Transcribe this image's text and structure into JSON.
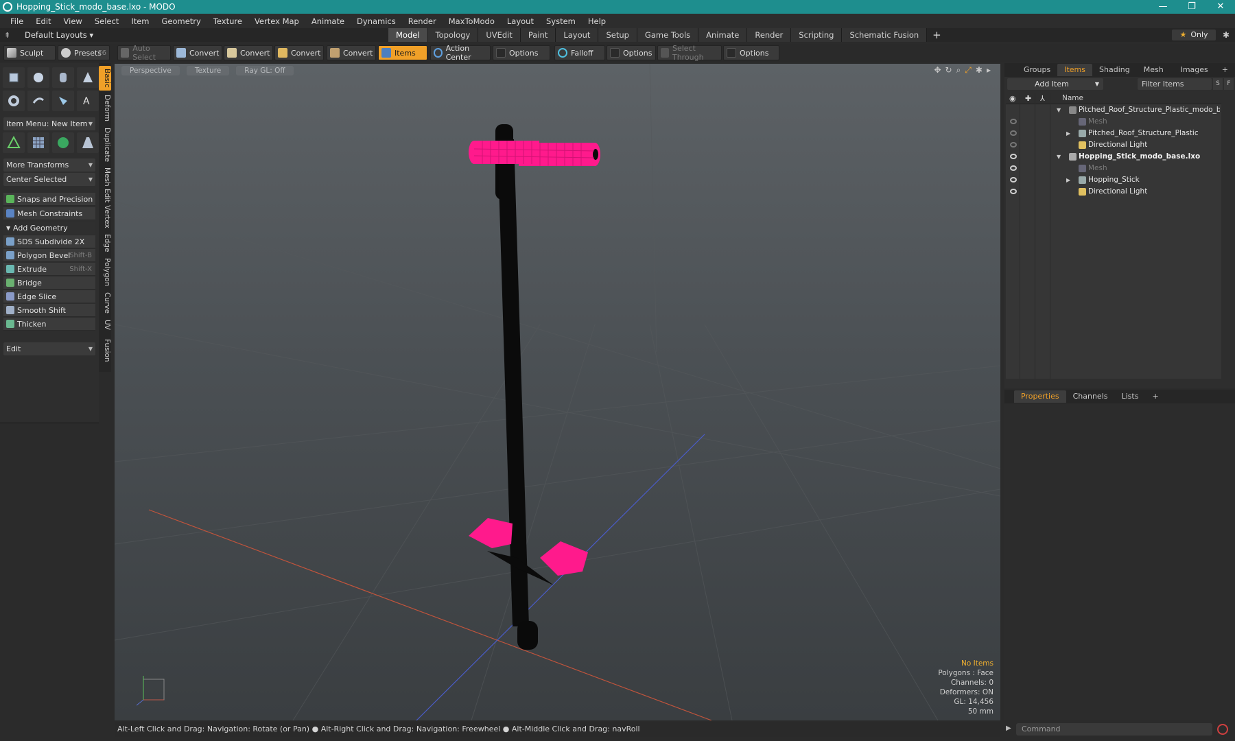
{
  "window": {
    "title": "Hopping_Stick_modo_base.lxo - MODO",
    "controls": [
      "—",
      "❐",
      "✕"
    ]
  },
  "menubar": [
    "File",
    "Edit",
    "View",
    "Select",
    "Item",
    "Geometry",
    "Texture",
    "Vertex Map",
    "Animate",
    "Dynamics",
    "Render",
    "MaxToModo",
    "Layout",
    "System",
    "Help"
  ],
  "layoutbar": {
    "layouts_label": "Default Layouts ▾",
    "tabs": [
      "Model",
      "Topology",
      "UVEdit",
      "Paint",
      "Layout",
      "Setup",
      "Game Tools",
      "Animate",
      "Render",
      "Scripting",
      "Schematic Fusion"
    ],
    "active_tab": "Model",
    "add_tab": "+",
    "only_label": "Only"
  },
  "toolbar": {
    "sculpt": "Sculpt",
    "presets": "Presets",
    "presets_shortcut": "F6",
    "auto_select": "Auto Select",
    "convert1": "Convert",
    "convert2": "Convert",
    "convert3": "Convert",
    "convert4": "Convert",
    "items": "Items",
    "action_center": "Action Center",
    "options1": "Options",
    "falloff": "Falloff",
    "options2": "Options",
    "select_through": "Select Through",
    "options3": "Options"
  },
  "leftpanel": {
    "item_menu": "Item Menu: New Item",
    "more_transforms": "More Transforms",
    "center_selected": "Center Selected",
    "snaps": "Snaps and Precision",
    "mesh_constraints": "Mesh Constraints",
    "add_geometry": "Add Geometry",
    "tools": [
      {
        "label": "SDS Subdivide 2X",
        "shortcut": ""
      },
      {
        "label": "Polygon Bevel",
        "shortcut": "Shift-B"
      },
      {
        "label": "Extrude",
        "shortcut": "Shift-X"
      },
      {
        "label": "Bridge",
        "shortcut": ""
      },
      {
        "label": "Edge Slice",
        "shortcut": ""
      },
      {
        "label": "Smooth Shift",
        "shortcut": ""
      },
      {
        "label": "Thicken",
        "shortcut": ""
      }
    ],
    "edit": "Edit",
    "vtabs": [
      "Basic",
      "Deform",
      "Duplicate",
      "Mesh Edit",
      "Vertex",
      "Edge",
      "Polygon",
      "Curve",
      "UV",
      "Fusion"
    ]
  },
  "viewport": {
    "view_label": "Perspective",
    "shading_label": "Texture",
    "raygl_label": "Ray GL: Off",
    "info": {
      "no_items": "No Items",
      "polygons": "Polygons : Face",
      "channels": "Channels: 0",
      "deformers": "Deformers: ON",
      "gl": "GL: 14,456",
      "scale": "50 mm"
    },
    "colors": {
      "accent_pink": "#ff1a8c",
      "stick_black": "#0a0a0a"
    }
  },
  "statusbar": {
    "text": "Alt-Left Click and Drag: Navigation: Rotate (or Pan) ● Alt-Right Click and Drag: Navigation: Freewheel ● Alt-Middle Click and Drag: navRoll"
  },
  "rightpanel": {
    "tabs": [
      "Groups",
      "Items",
      "Shading",
      "Mesh ...",
      "Images",
      "+"
    ],
    "active_tab": "Items",
    "add_item": "Add Item",
    "filter_items": "Filter Items",
    "s_btn": "S",
    "f_btn": "F",
    "name_col": "Name",
    "tree": [
      {
        "label": "Pitched_Roof_Structure_Plastic_modo_bas...",
        "style": "normal"
      },
      {
        "label": "Mesh",
        "style": "dim"
      },
      {
        "label": "Pitched_Roof_Structure_Plastic",
        "style": "normal"
      },
      {
        "label": "Directional Light",
        "style": "normal"
      },
      {
        "label": "Hopping_Stick_modo_base.lxo",
        "style": "bold"
      },
      {
        "label": "Mesh",
        "style": "dim"
      },
      {
        "label": "Hopping_Stick",
        "style": "normal"
      },
      {
        "label": "Directional Light",
        "style": "normal"
      }
    ],
    "bottom_tabs": [
      "Properties",
      "Channels",
      "Lists",
      "+"
    ],
    "bottom_active": "Properties",
    "command_placeholder": "Command"
  }
}
